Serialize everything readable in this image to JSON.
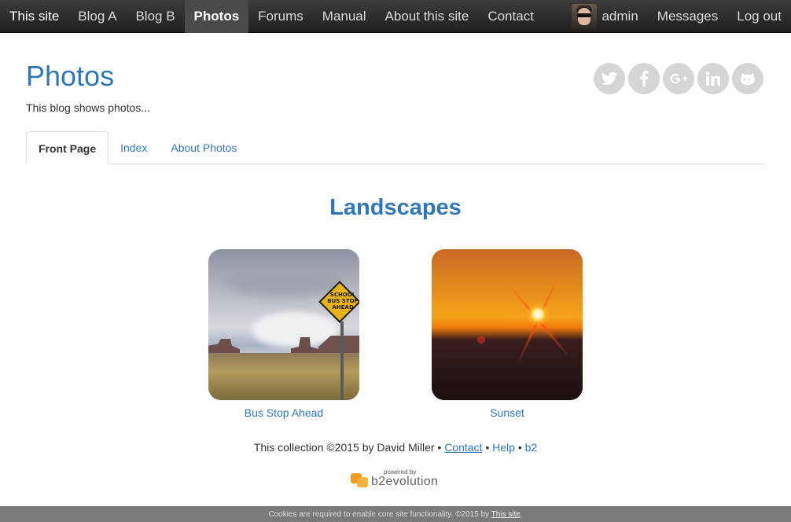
{
  "navbar": {
    "brand": "This site",
    "items": [
      {
        "label": "Blog A"
      },
      {
        "label": "Blog B"
      },
      {
        "label": "Photos"
      },
      {
        "label": "Forums"
      },
      {
        "label": "Manual"
      },
      {
        "label": "About this site"
      },
      {
        "label": "Contact"
      }
    ],
    "user": "admin",
    "messages": "Messages",
    "logout": "Log out"
  },
  "header": {
    "title": "Photos",
    "tagline": "This blog shows photos..."
  },
  "social": [
    "twitter-icon",
    "facebook-icon",
    "google-plus-icon",
    "linkedin-icon",
    "github-icon"
  ],
  "tabs": [
    {
      "label": "Front Page"
    },
    {
      "label": "Index"
    },
    {
      "label": "About Photos"
    }
  ],
  "collection": {
    "title": "Landscapes",
    "photos": [
      {
        "caption": "Bus Stop Ahead",
        "sign_text": "SCHOOL BUS STOP AHEAD"
      },
      {
        "caption": "Sunset"
      }
    ]
  },
  "footer": {
    "text": "This collection ©2015 by David Miller",
    "sep": "•",
    "contact": "Contact",
    "help": "Help",
    "b2": "b2",
    "powered_small": "powered by",
    "powered_word": "b2evolution"
  },
  "cookie": {
    "text": "Cookies are required to enable core site functionality. ©2015 by",
    "link": "This site",
    "end": "."
  },
  "colors": {
    "accent": "#3277b5",
    "navbar": "#2b2b2b",
    "cookie_bar": "#7a7a7a"
  }
}
